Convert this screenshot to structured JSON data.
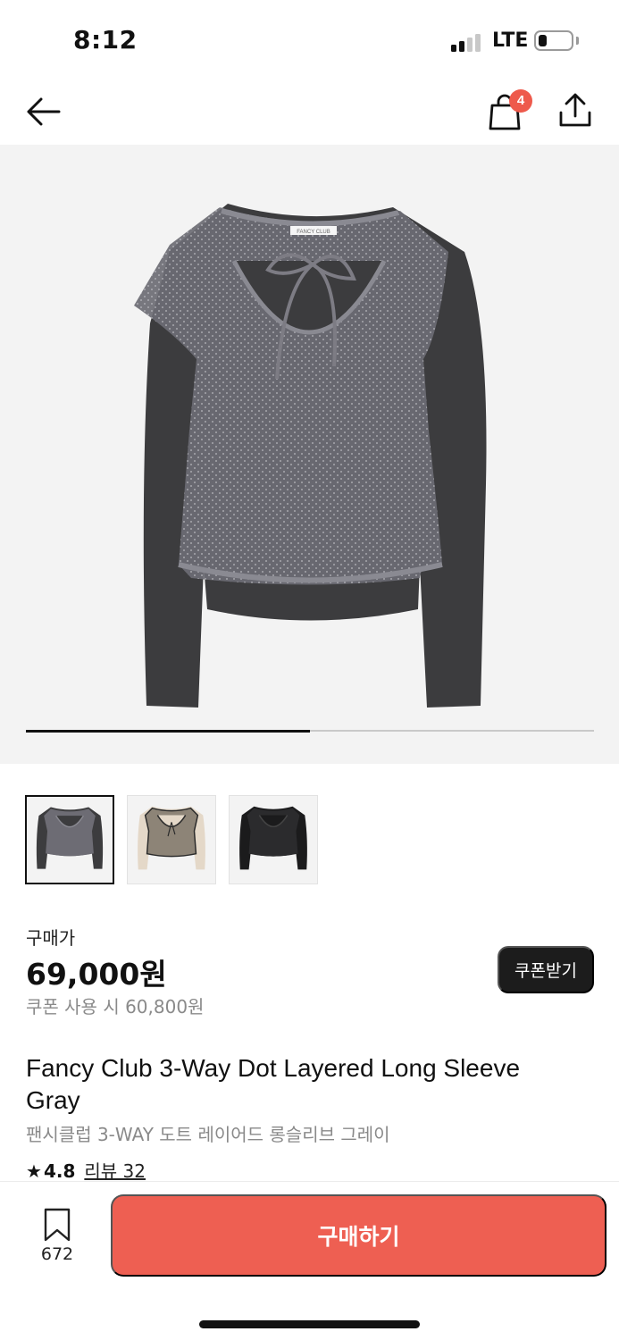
{
  "status_bar": {
    "time": "8:12",
    "network": "LTE"
  },
  "header": {
    "cart_count": "4",
    "back_icon": "arrow-left-icon",
    "cart_icon": "shopping-bag-icon",
    "share_icon": "share-icon"
  },
  "gallery": {
    "image_count": 2,
    "current_index": 1,
    "product_label_text": "FANCY CLUB",
    "thumbnails": [
      "gray",
      "beige",
      "black"
    ]
  },
  "price": {
    "label": "구매가",
    "value": "69,000원",
    "coupon_price": "쿠폰 사용 시 60,800원",
    "coupon_button": "쿠폰받기"
  },
  "product": {
    "name_en": "Fancy Club 3-Way Dot Layered Long Sleeve Gray",
    "name_ko": "팬시클럽 3-WAY 도트 레이어드 롱슬리브 그레이",
    "rating": "4.8",
    "review_link": "리뷰 32"
  },
  "bottom_bar": {
    "wishlist_count": "672",
    "buy_button": "구매하기"
  },
  "colors": {
    "accent": "#ee5f52",
    "badge": "#ee5a4c",
    "dark": "#1c1c1c"
  }
}
